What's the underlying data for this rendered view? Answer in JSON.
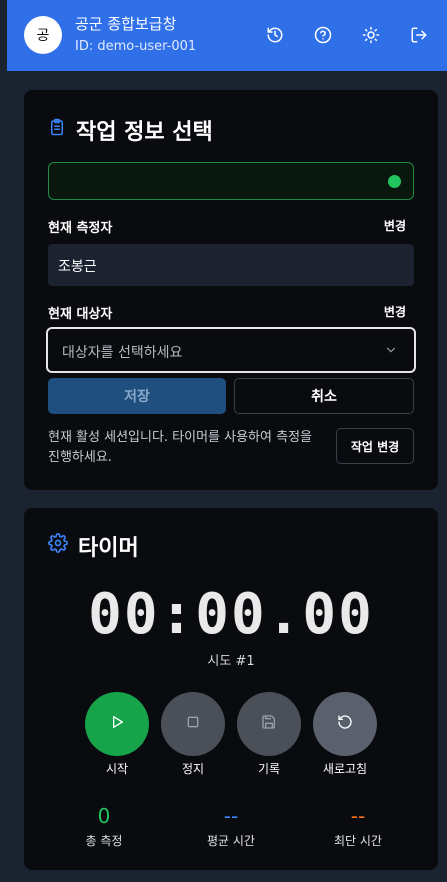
{
  "header": {
    "avatar_initial": "공",
    "title": "공군 종합보급창",
    "user_id": "ID: demo-user-001",
    "icons": [
      "history-icon",
      "help-icon",
      "theme-toggle-icon",
      "logout-icon"
    ]
  },
  "task_card": {
    "title": "작업 정보 선택",
    "status_color": "#22c55e",
    "measurer_label": "현재 측정자",
    "measurer_change": "변경",
    "measurer_value": "조봉근",
    "target_label": "현재 대상자",
    "target_change": "변경",
    "target_placeholder": "대상자를 선택하세요",
    "save_label": "저장",
    "cancel_label": "취소",
    "session_text": "현재 활성 세션입니다. 타이머를 사용하여 측정을 진행하세요.",
    "change_task_label": "작업 변경"
  },
  "timer_card": {
    "title": "타이머",
    "display": "00:00.00",
    "attempt": "시도 #1",
    "controls": {
      "start": "시작",
      "stop": "정지",
      "record": "기록",
      "refresh": "새로고침"
    },
    "stats": {
      "total_value": "0",
      "total_label": "총 측정",
      "avg_value": "--",
      "avg_label": "평균 시간",
      "min_value": "--",
      "min_label": "최단 시간"
    }
  },
  "colors": {
    "header_bg": "#2f6fe8",
    "accent_blue": "#3b82f6",
    "start_green": "#16a34a",
    "total_green": "#22c55e",
    "avg_blue": "#3b82f6",
    "min_orange": "#f97316"
  }
}
